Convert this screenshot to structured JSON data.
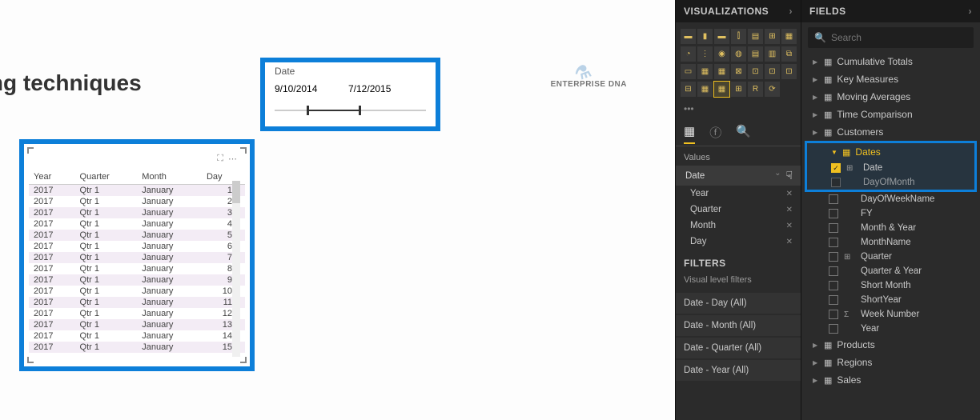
{
  "pageTitle": "hing techniques",
  "logo": "ENTERPRISE DNA",
  "dateSlicer": {
    "label": "Date",
    "start": "9/10/2014",
    "end": "7/12/2015"
  },
  "table": {
    "headers": [
      "Year",
      "Quarter",
      "Month",
      "Day"
    ],
    "rows": [
      [
        "2017",
        "Qtr 1",
        "January",
        "1"
      ],
      [
        "2017",
        "Qtr 1",
        "January",
        "2"
      ],
      [
        "2017",
        "Qtr 1",
        "January",
        "3"
      ],
      [
        "2017",
        "Qtr 1",
        "January",
        "4"
      ],
      [
        "2017",
        "Qtr 1",
        "January",
        "5"
      ],
      [
        "2017",
        "Qtr 1",
        "January",
        "6"
      ],
      [
        "2017",
        "Qtr 1",
        "January",
        "7"
      ],
      [
        "2017",
        "Qtr 1",
        "January",
        "8"
      ],
      [
        "2017",
        "Qtr 1",
        "January",
        "9"
      ],
      [
        "2017",
        "Qtr 1",
        "January",
        "10"
      ],
      [
        "2017",
        "Qtr 1",
        "January",
        "11"
      ],
      [
        "2017",
        "Qtr 1",
        "January",
        "12"
      ],
      [
        "2017",
        "Qtr 1",
        "January",
        "13"
      ],
      [
        "2017",
        "Qtr 1",
        "January",
        "14"
      ],
      [
        "2017",
        "Qtr 1",
        "January",
        "15"
      ]
    ]
  },
  "vizPanel": {
    "title": "VISUALIZATIONS",
    "valuesLabel": "Values",
    "valueFields": {
      "group": "Date",
      "items": [
        "Year",
        "Quarter",
        "Month",
        "Day"
      ]
    },
    "filtersTitle": "FILTERS",
    "filtersSub": "Visual level filters",
    "filters": [
      "Date - Day (All)",
      "Date - Month (All)",
      "Date - Quarter (All)",
      "Date - Year (All)"
    ]
  },
  "fieldsPanel": {
    "title": "FIELDS",
    "searchPlaceholder": "Search",
    "tables": [
      {
        "name": "Cumulative Totals",
        "expanded": false
      },
      {
        "name": "Key Measures",
        "expanded": false
      },
      {
        "name": "Moving Averages",
        "expanded": false
      },
      {
        "name": "Time Comparison",
        "expanded": false
      },
      {
        "name": "Customers",
        "expanded": false
      }
    ],
    "highlightedTable": {
      "name": "Dates",
      "checkedField": "Date",
      "partialField": "DayOfMonth"
    },
    "dateColumns": [
      {
        "name": "DayOfWeekName",
        "checked": false,
        "type": ""
      },
      {
        "name": "FY",
        "checked": false,
        "type": ""
      },
      {
        "name": "Month & Year",
        "checked": false,
        "type": ""
      },
      {
        "name": "MonthName",
        "checked": false,
        "type": ""
      },
      {
        "name": "Quarter",
        "checked": false,
        "type": "hier"
      },
      {
        "name": "Quarter & Year",
        "checked": false,
        "type": ""
      },
      {
        "name": "Short Month",
        "checked": false,
        "type": ""
      },
      {
        "name": "ShortYear",
        "checked": false,
        "type": ""
      },
      {
        "name": "Week Number",
        "checked": false,
        "type": "num"
      },
      {
        "name": "Year",
        "checked": false,
        "type": ""
      }
    ],
    "otherTables": [
      "Products",
      "Regions",
      "Sales"
    ]
  }
}
